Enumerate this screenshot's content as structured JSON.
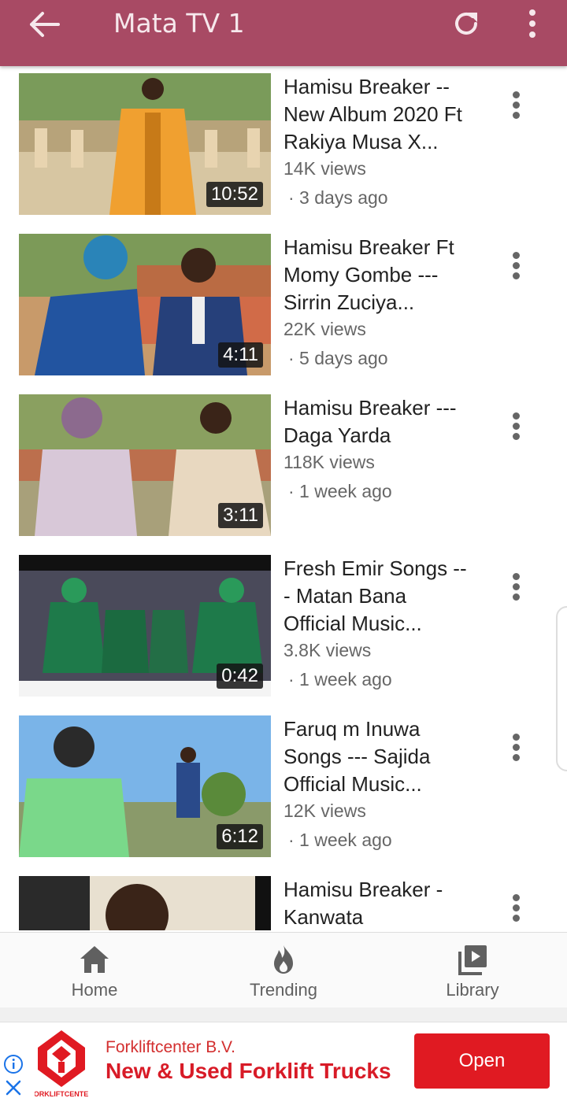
{
  "appbar": {
    "title": "Mata TV 1",
    "back_icon": "arrow-back-icon",
    "refresh_icon": "refresh-icon",
    "menu_icon": "more-vert-icon",
    "color": "#a84a64"
  },
  "videos": [
    {
      "title": "Hamisu Breaker -- New Album 2020 Ft Rakiya Musa X...",
      "views": "14K views",
      "ago": "· 3 days ago",
      "duration": "10:52"
    },
    {
      "title": "Hamisu Breaker Ft Momy Gombe --- Sirrin Zuciya...",
      "views": "22K views",
      "ago": "· 5 days ago",
      "duration": "4:11"
    },
    {
      "title": "Hamisu Breaker --- Daga Yarda",
      "views": "118K views",
      "ago": "· 1 week ago",
      "duration": "3:11"
    },
    {
      "title": "Fresh Emir Songs --- Matan Bana Official Music...",
      "views": "3.8K views",
      "ago": "· 1 week ago",
      "duration": "0:42"
    },
    {
      "title": "Faruq m Inuwa Songs --- Sajida Official Music...",
      "views": "12K views",
      "ago": "· 1 week ago",
      "duration": "6:12"
    },
    {
      "title": "Hamisu Breaker - Kanwata",
      "views": "",
      "ago": "",
      "duration": ""
    }
  ],
  "bottom_nav": {
    "home": "Home",
    "trending": "Trending",
    "library": "Library"
  },
  "ad": {
    "advertiser": "Forkliftcenter B.V.",
    "headline": "New & Used Forklift Trucks",
    "cta": "Open",
    "logo_text": "FORKLIFTCENTER",
    "brand_color": "#e01a22"
  }
}
